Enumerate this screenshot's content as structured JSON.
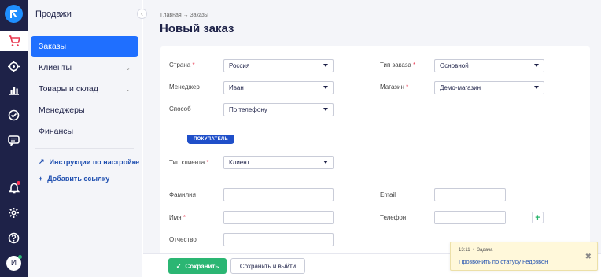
{
  "sidebar": {
    "title": "Продажи",
    "items": [
      {
        "label": "Заказы"
      },
      {
        "label": "Клиенты"
      },
      {
        "label": "Товары и склад"
      },
      {
        "label": "Менеджеры"
      },
      {
        "label": "Финансы"
      }
    ],
    "links": [
      {
        "label": "Инструкции по настройке"
      },
      {
        "label": "Добавить ссылку"
      }
    ]
  },
  "user": {
    "avatar_letter": "И"
  },
  "header": {
    "breadcrumb": "Главная → Заказы",
    "title": "Новый заказ"
  },
  "order": {
    "country": {
      "label": "Страна",
      "value": "Россия"
    },
    "order_type": {
      "label": "Тип заказа",
      "value": "Основной"
    },
    "manager": {
      "label": "Менеджер",
      "value": "Иван"
    },
    "shop": {
      "label": "Магазин",
      "value": "Демо-магазин"
    },
    "method": {
      "label": "Способ",
      "value": "По телефону"
    }
  },
  "customer": {
    "section_badge": "ПОКУПАТЕЛЬ",
    "client_type": {
      "label": "Тип клиента",
      "value": "Клиент"
    },
    "last_name": {
      "label": "Фамилия",
      "value": ""
    },
    "first_name": {
      "label": "Имя",
      "value": ""
    },
    "patronymic": {
      "label": "Отчество",
      "value": ""
    },
    "email": {
      "label": "Email",
      "value": ""
    },
    "phone": {
      "label": "Телефон",
      "value": ""
    }
  },
  "footer": {
    "save_label": "Сохранить",
    "save_exit_label": "Сохранить и выйти"
  },
  "toast": {
    "time": "13:11",
    "kind": "Задача",
    "text": "Прозвонить по статусу недозвон"
  },
  "colors": {
    "rail": "#1e2248",
    "accent": "#1f6fff",
    "success": "#2bb673",
    "required": "#e8364e"
  }
}
